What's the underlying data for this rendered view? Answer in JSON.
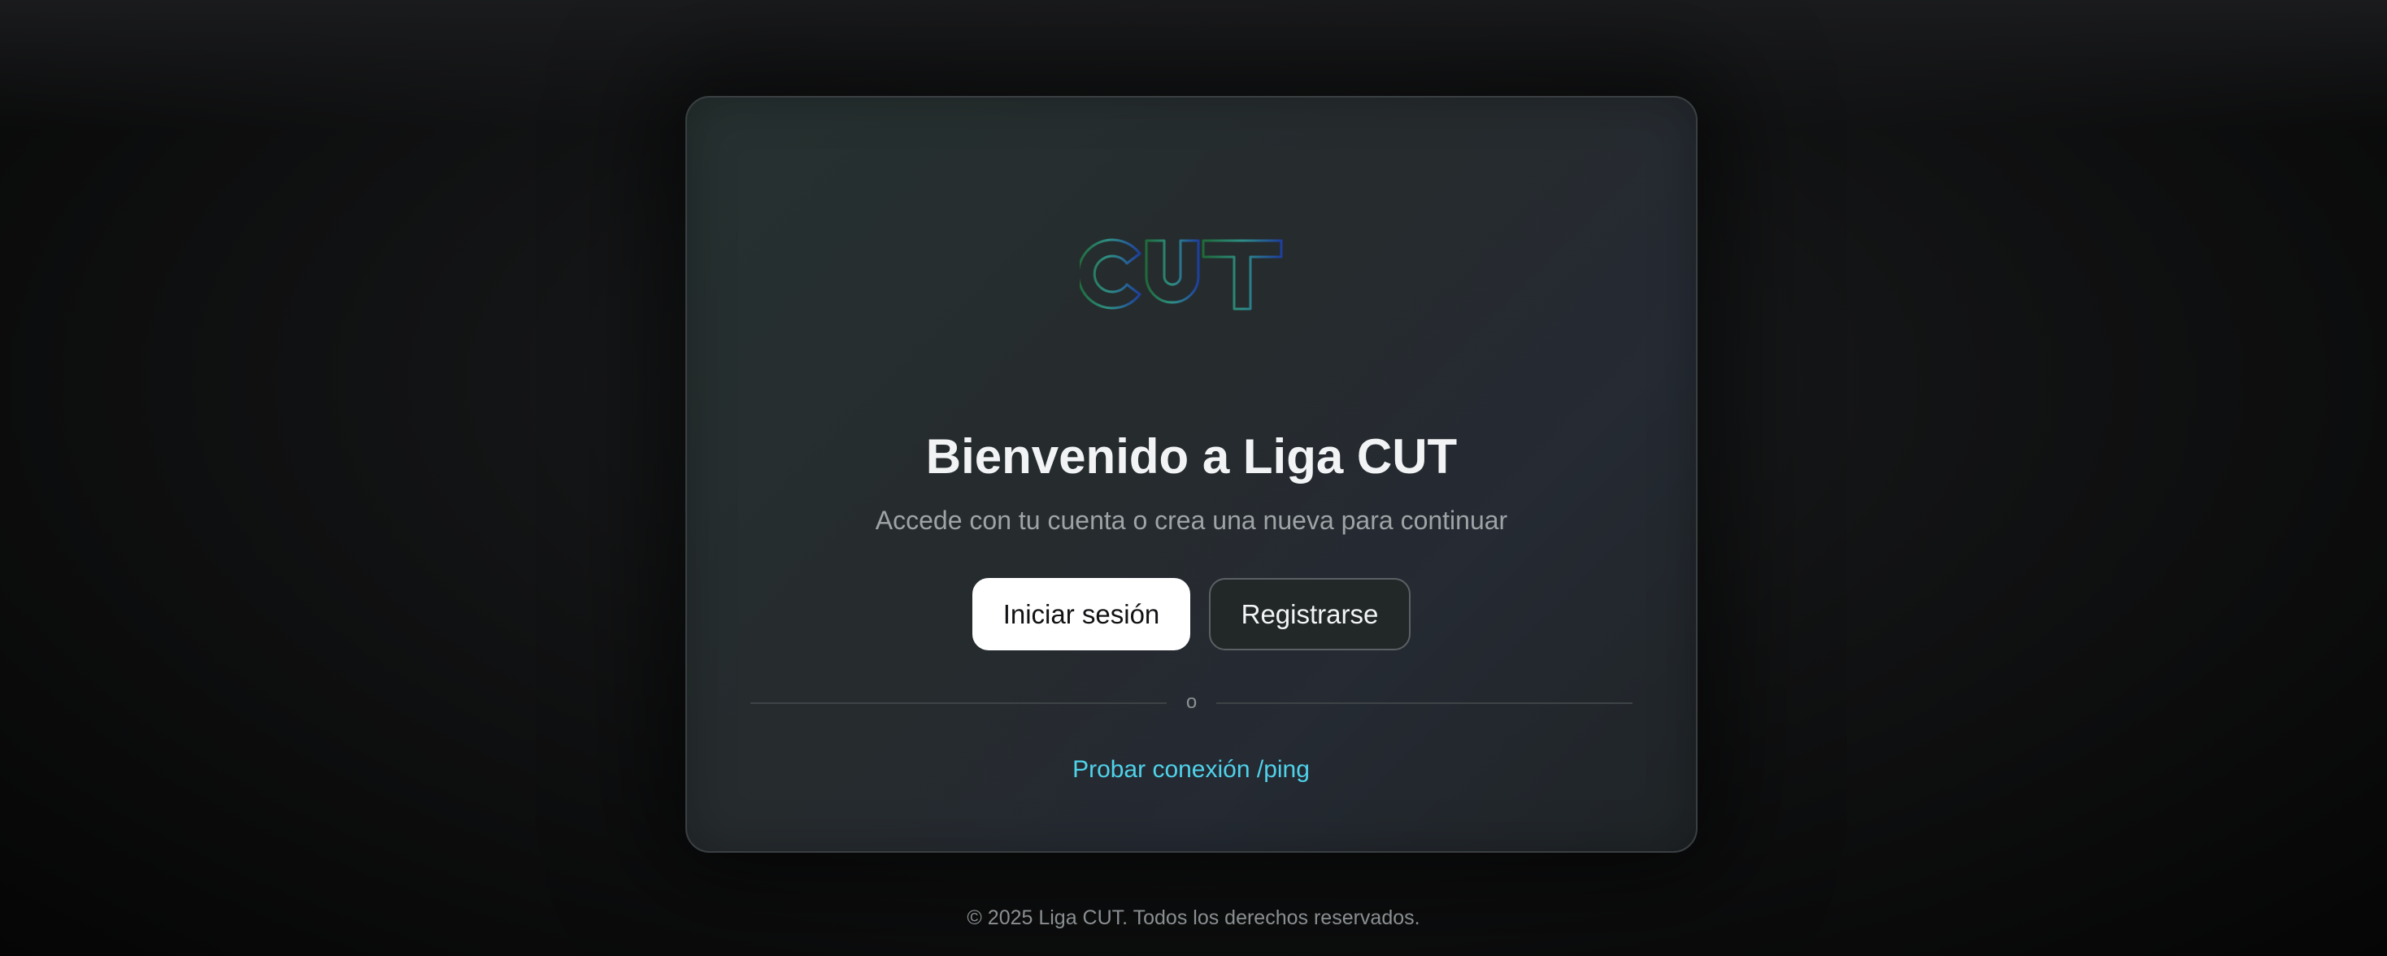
{
  "brand": {
    "logo_text": "CUT",
    "logo_gradient": [
      "#1f6b3a",
      "#2f8f86",
      "#1e3f9e"
    ]
  },
  "main": {
    "title": "Bienvenido a Liga CUT",
    "subtitle": "Accede con tu cuenta o crea una nueva para continuar",
    "login_label": "Iniciar sesión",
    "register_label": "Registrarse",
    "divider_text": "o",
    "ping_label": "Probar conexión /ping"
  },
  "footer": {
    "copyright": "© 2025 Liga CUT. Todos los derechos reservados."
  },
  "colors": {
    "accent": "#4fd2ea",
    "background": "#0a0a0b",
    "card": "#262b2e"
  }
}
